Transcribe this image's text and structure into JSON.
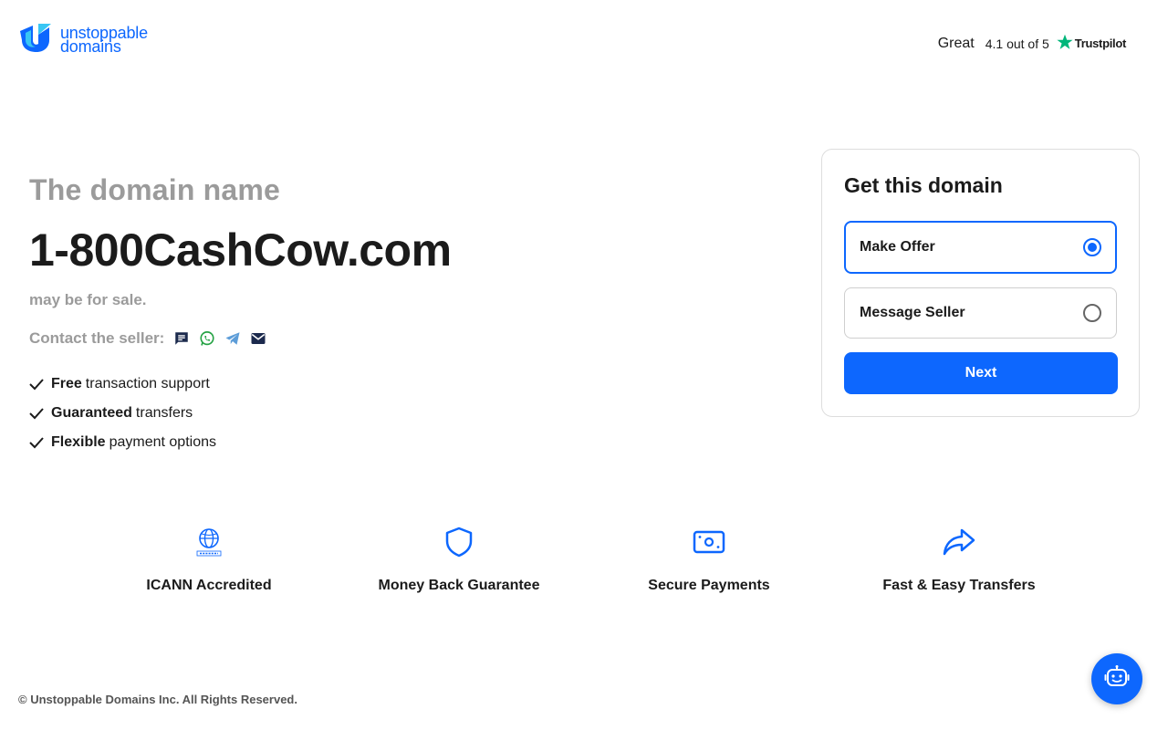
{
  "brand": {
    "line1": "unstoppable",
    "line2": "domains",
    "logo_icon": "unstoppable-logo-icon",
    "color": "#0d67fe"
  },
  "trustpilot": {
    "label": "Great",
    "rating": "4.1 out of 5",
    "brand": "Trustpilot",
    "star_color": "#00b67a"
  },
  "hero": {
    "subtitle": "The domain name",
    "domain": "1-800CashCow.com",
    "sale_text": "may be for sale.",
    "contact_label": "Contact the seller:",
    "contact_icons": [
      "message-icon",
      "whatsapp-icon",
      "telegram-icon",
      "email-icon"
    ]
  },
  "features": [
    {
      "bold": "Free",
      "text": "transaction support"
    },
    {
      "bold": "Guaranteed",
      "text": "transfers"
    },
    {
      "bold": "Flexible",
      "text": "payment options"
    }
  ],
  "card": {
    "title": "Get this domain",
    "options": [
      {
        "label": "Make Offer",
        "selected": true
      },
      {
        "label": "Message Seller",
        "selected": false
      }
    ],
    "button": "Next"
  },
  "badges": [
    {
      "label": "ICANN Accredited",
      "icon": "icann-icon"
    },
    {
      "label": "Money Back Guarantee",
      "icon": "shield-icon"
    },
    {
      "label": "Secure Payments",
      "icon": "money-icon"
    },
    {
      "label": "Fast & Easy Transfers",
      "icon": "share-arrow-icon"
    }
  ],
  "footer": "© Unstoppable Domains Inc. All Rights Reserved.",
  "chat": {
    "icon": "chatbot-icon"
  },
  "colors": {
    "accent": "#0d67fe",
    "muted": "#9b9b9b",
    "text": "#1b1b1b"
  }
}
